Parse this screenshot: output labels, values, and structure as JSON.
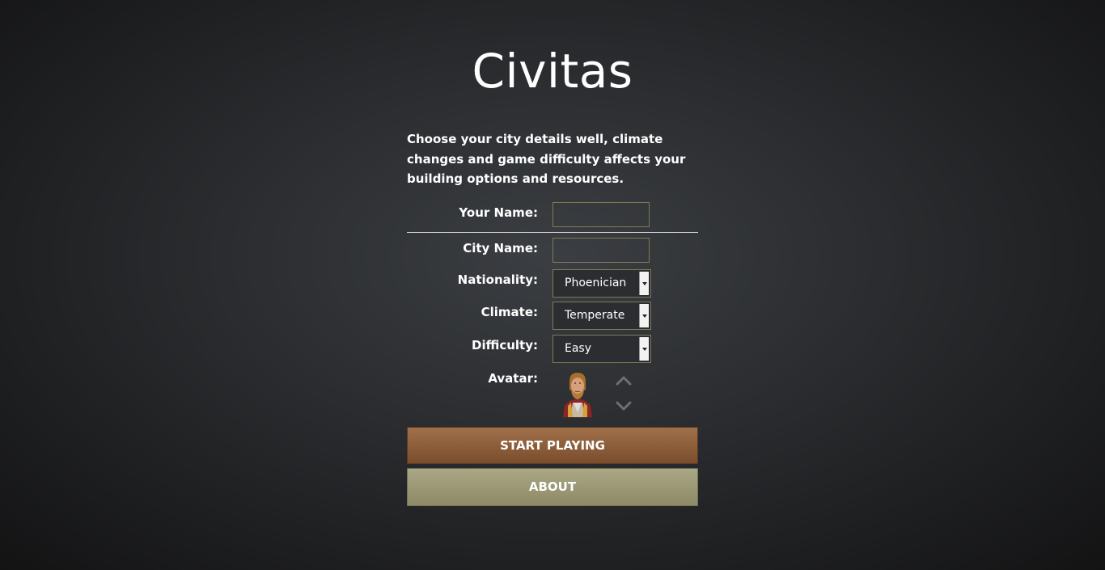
{
  "app": {
    "title": "Civitas",
    "intro": "Choose your city details well, climate changes and game difficulty affects your building options and resources."
  },
  "form": {
    "your_name": {
      "label": "Your Name:",
      "value": ""
    },
    "city_name": {
      "label": "City Name:",
      "value": ""
    },
    "nationality": {
      "label": "Nationality:",
      "selected": "Phoenician"
    },
    "climate": {
      "label": "Climate:",
      "selected": "Temperate"
    },
    "difficulty": {
      "label": "Difficulty:",
      "selected": "Easy"
    },
    "avatar": {
      "label": "Avatar:"
    }
  },
  "buttons": {
    "start": "START PLAYING",
    "about": "ABOUT"
  },
  "icons": {
    "avatar_prev": "chevron-up-icon",
    "avatar_next": "chevron-down-icon",
    "select_arrow": "caret-down-icon"
  },
  "colors": {
    "start_button": "#8a5a36",
    "about_button": "#9c9977",
    "field_border": "#7d7b58"
  }
}
